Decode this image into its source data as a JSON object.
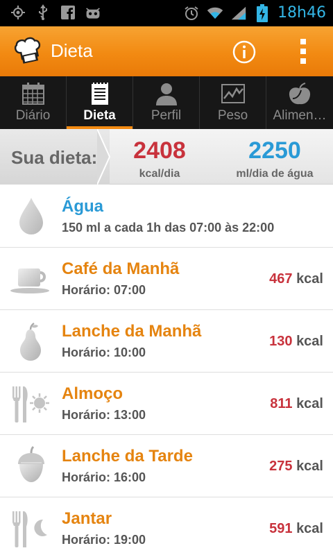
{
  "status_bar": {
    "time": "18h46",
    "icons": [
      "gps-icon",
      "usb-icon",
      "facebook-icon",
      "android-icon",
      "alarm-icon",
      "wifi-icon",
      "signal-icon",
      "battery-charging-icon"
    ]
  },
  "action_bar": {
    "title": "Dieta",
    "logo": "chef-hat-icon",
    "info_icon": "info-icon",
    "menu_icon": "overflow-menu-icon"
  },
  "tabs": [
    {
      "label": "Diário",
      "icon": "calendar-icon",
      "active": false
    },
    {
      "label": "Dieta",
      "icon": "notepad-icon",
      "active": true
    },
    {
      "label": "Perfil",
      "icon": "person-icon",
      "active": false
    },
    {
      "label": "Peso",
      "icon": "chart-icon",
      "active": false
    },
    {
      "label": "Alimen…",
      "icon": "apple-icon",
      "active": false
    }
  ],
  "summary": {
    "label": "Sua dieta:",
    "kcal_value": "2408",
    "kcal_unit": "kcal/dia",
    "water_value": "2250",
    "water_unit": "ml/dia de água"
  },
  "meals": [
    {
      "title": "Água",
      "subtitle": "150 ml a cada 1h das 07:00 às 22:00",
      "kcal": "",
      "unit": "",
      "icon": "water-drop-icon"
    },
    {
      "title": "Café da Manhã",
      "subtitle": "Horário: 07:00",
      "kcal": "467",
      "unit": "kcal",
      "icon": "coffee-cup-icon"
    },
    {
      "title": "Lanche da Manhã",
      "subtitle": "Horário: 10:00",
      "kcal": "130",
      "unit": "kcal",
      "icon": "pear-icon"
    },
    {
      "title": "Almoço",
      "subtitle": "Horário: 13:00",
      "kcal": "811",
      "unit": "kcal",
      "icon": "cutlery-sun-icon"
    },
    {
      "title": "Lanche da Tarde",
      "subtitle": "Horário: 16:00",
      "kcal": "275",
      "unit": "kcal",
      "icon": "acorn-icon"
    },
    {
      "title": "Jantar",
      "subtitle": "Horário: 19:00",
      "kcal": "591",
      "unit": "kcal",
      "icon": "cutlery-moon-icon"
    }
  ],
  "colors": {
    "accent_orange": "#f28a12",
    "water_blue": "#2a9ad6",
    "kcal_red": "#c8323c",
    "status_blue": "#33b5e5"
  }
}
